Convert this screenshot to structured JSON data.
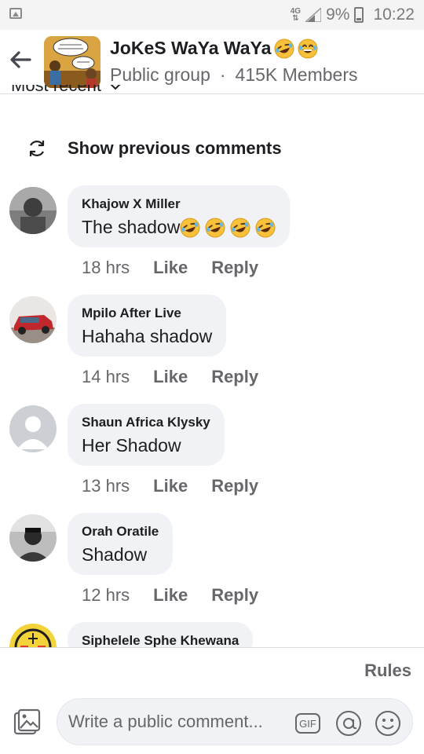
{
  "status_bar": {
    "network": "4G",
    "battery": "9%",
    "time": "10:22",
    "icons": [
      "image-icon",
      "network-4g-icon",
      "signal-icon",
      "battery-icon"
    ]
  },
  "header": {
    "group_name": "JoKeS WaYa WaYa",
    "emojis": [
      "rolling-laughing-emoji",
      "grin-sweat-emoji"
    ],
    "privacy": "Public group",
    "separator": "·",
    "members": "415K Members"
  },
  "sort": {
    "label": "Most recent",
    "icon": "chevron-down-icon"
  },
  "previous_comments": {
    "label": "Show previous comments",
    "icon": "refresh-icon"
  },
  "comments": [
    {
      "author": "Khajow X Miller",
      "text": "The shadow",
      "emoji_count": 4,
      "time": "18 hrs",
      "like": "Like",
      "reply": "Reply"
    },
    {
      "author": "Mpilo After Live",
      "text": "Hahaha shadow",
      "emoji_count": 0,
      "time": "14 hrs",
      "like": "Like",
      "reply": "Reply"
    },
    {
      "author": "Shaun Africa Klysky",
      "text": "Her Shadow",
      "emoji_count": 0,
      "time": "13 hrs",
      "like": "Like",
      "reply": "Reply"
    },
    {
      "author": "Orah Oratile",
      "text": "Shadow",
      "emoji_count": 0,
      "time": "12 hrs",
      "like": "Like",
      "reply": "Reply"
    },
    {
      "author": "Siphelele Sphe Khewana",
      "text": "",
      "emoji_count": 0,
      "time": "",
      "like": "",
      "reply": ""
    }
  ],
  "bottom": {
    "rules_label": "Rules",
    "composer_placeholder": "Write a public comment...",
    "icons": [
      "gallery-icon",
      "gif-icon",
      "mention-icon",
      "smiley-icon"
    ],
    "gif_label": "GIF"
  },
  "colors": {
    "bubble_bg": "#f0f2f5",
    "meta_text": "#65676b",
    "primary_text": "#1c1e21",
    "status_bar_bg": "#f4f4f4"
  }
}
